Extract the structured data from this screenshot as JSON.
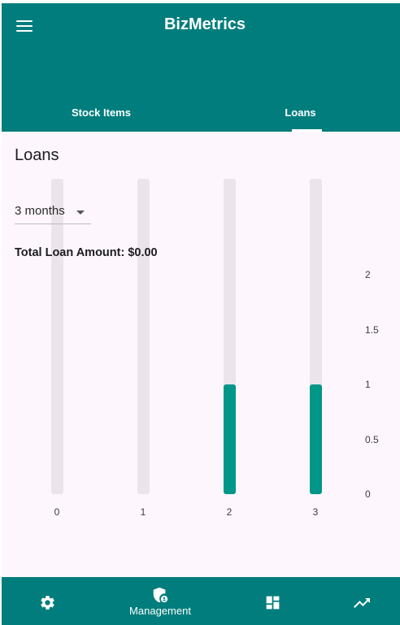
{
  "app": {
    "title": "BizMetrics"
  },
  "tabs": [
    {
      "label": "Stock Items",
      "active": false
    },
    {
      "label": "Loans",
      "active": true
    }
  ],
  "content": {
    "title": "Loans",
    "period": {
      "selected": "3 months"
    },
    "total_label": "Total Loan Amount: $0.00"
  },
  "chart_data": {
    "type": "bar",
    "categories": [
      "0",
      "1",
      "2",
      "3"
    ],
    "values": [
      0,
      0,
      1,
      1
    ],
    "ylim": [
      0,
      2
    ],
    "yticks": [
      "0",
      "0.5",
      "1",
      "1.5",
      "2"
    ],
    "bar_color": "#009688",
    "track_color": "#ebe5eb"
  },
  "bottom_nav": {
    "management_label": "Management"
  },
  "colors": {
    "primary": "#027d7d",
    "accent": "#009688",
    "background": "#fdf7fd"
  }
}
